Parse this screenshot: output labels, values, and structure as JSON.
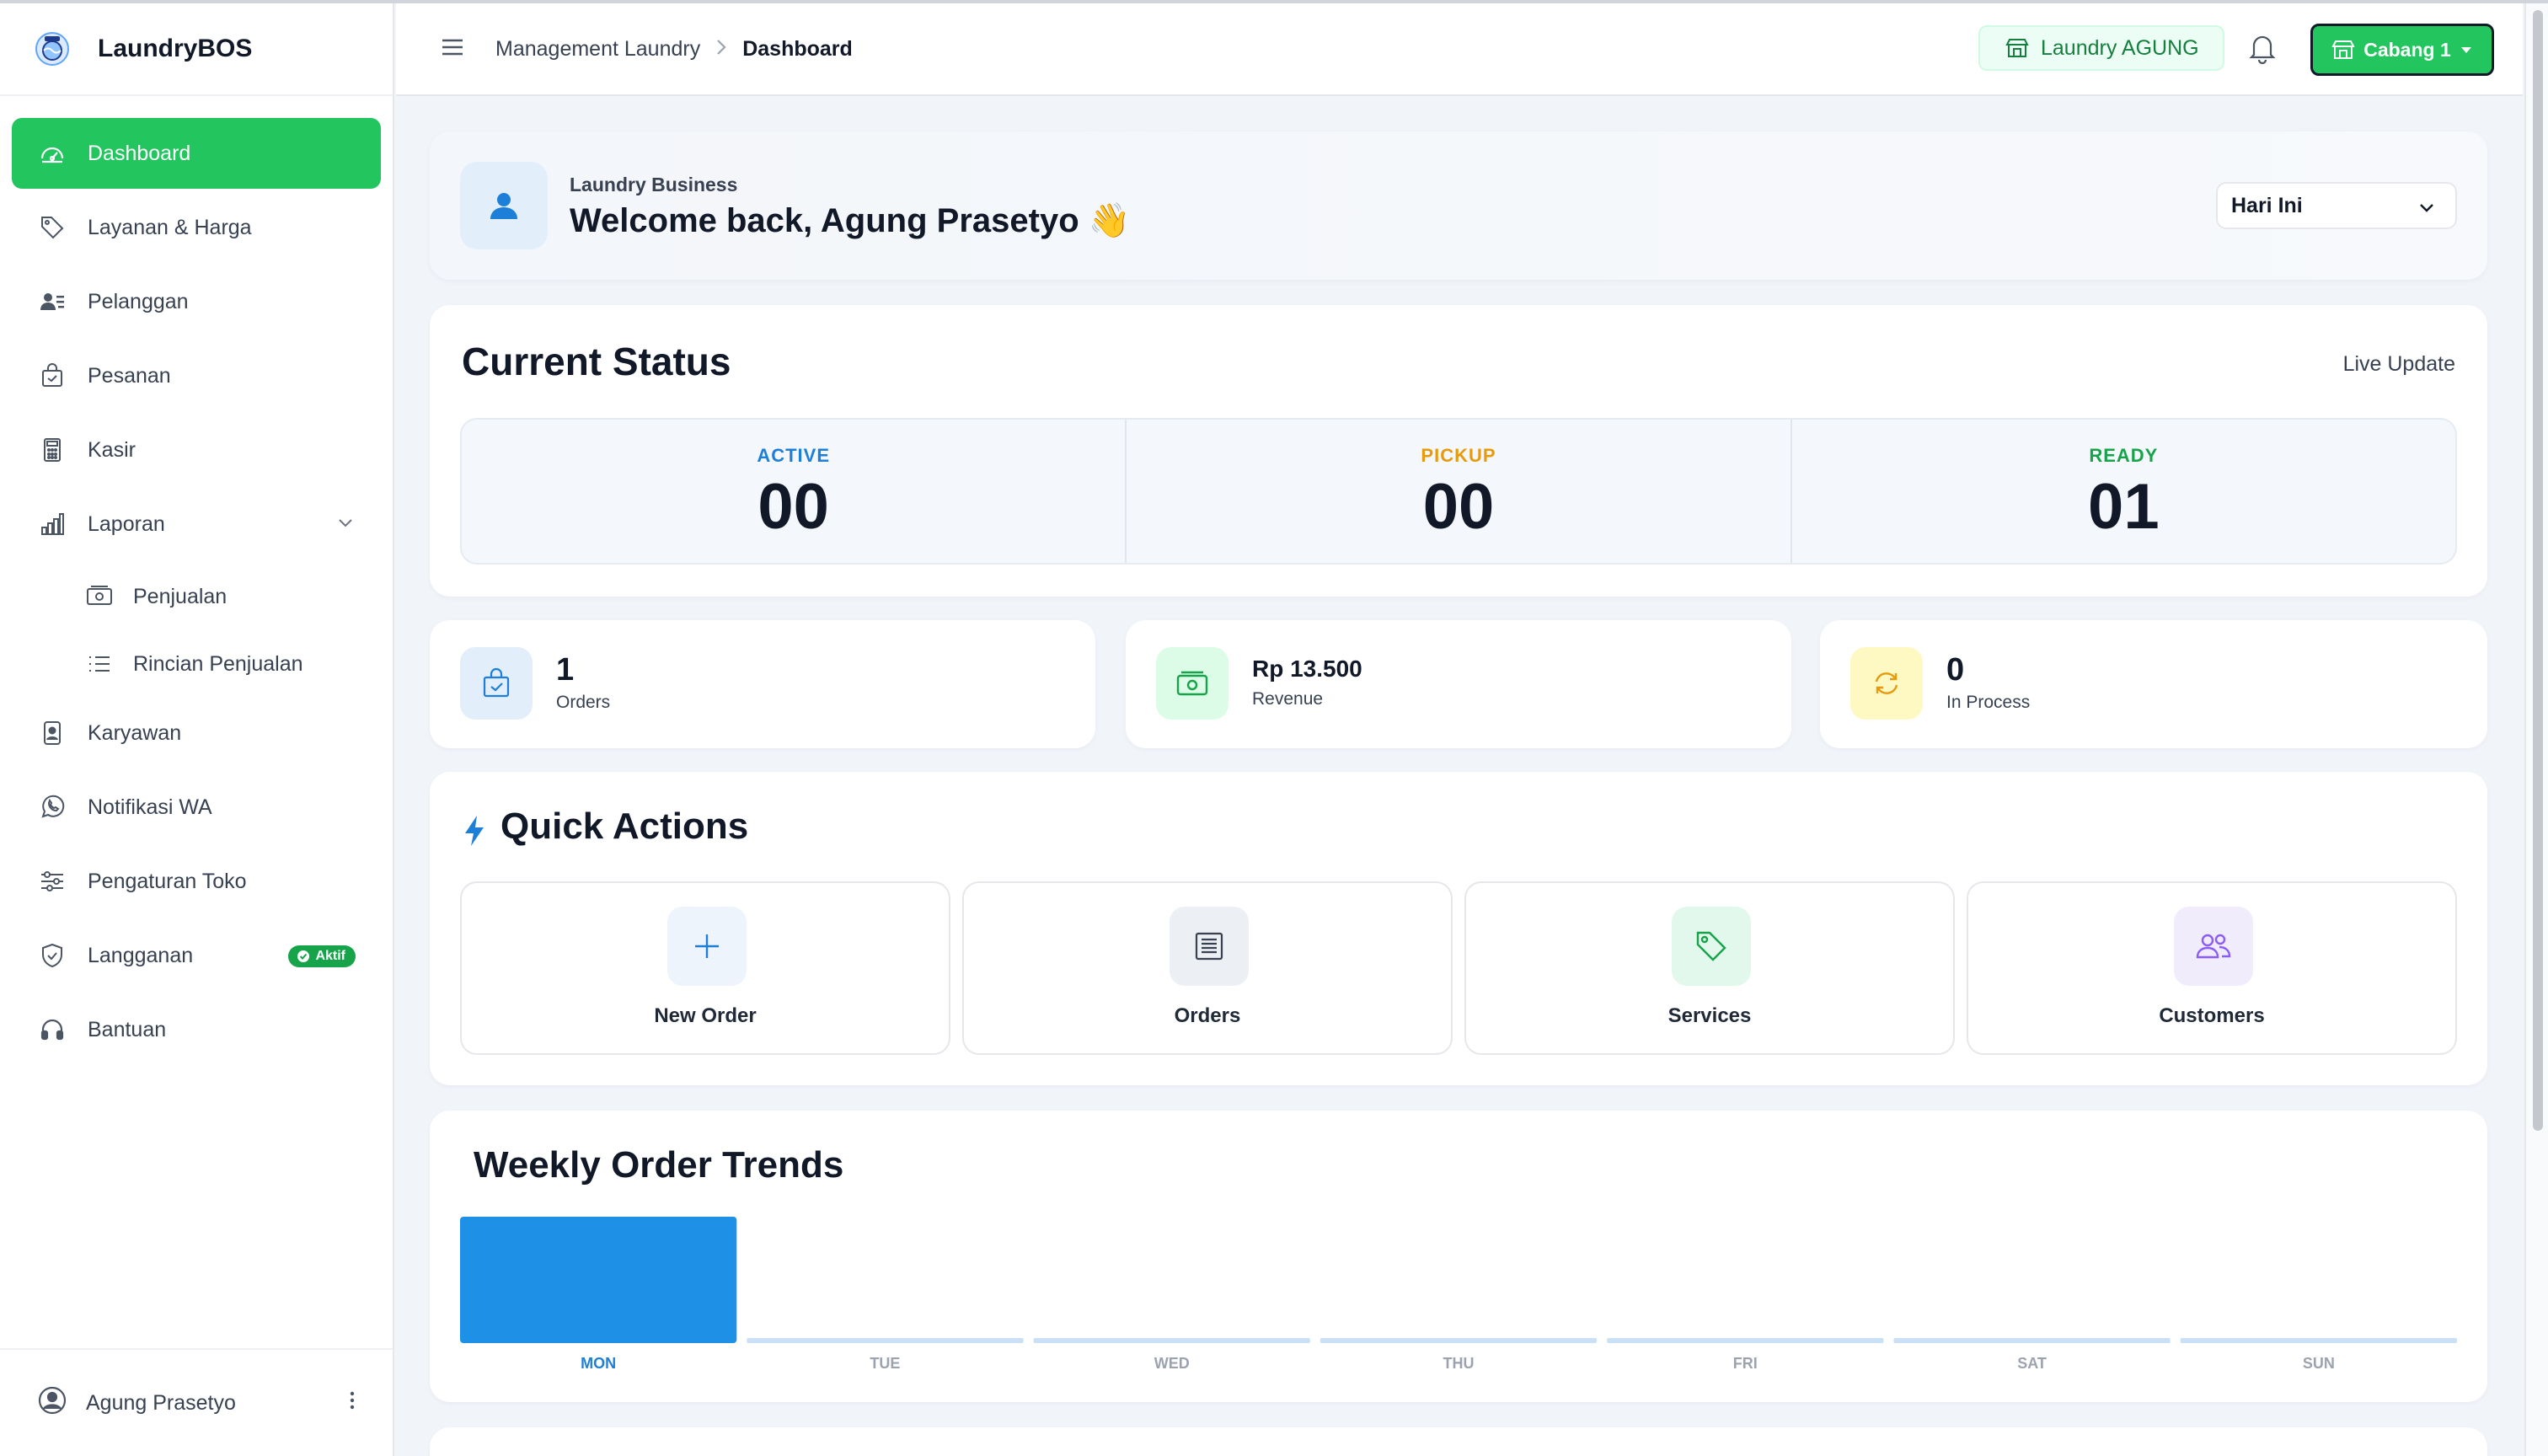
{
  "brand": {
    "name": "LaundryBOS"
  },
  "sidebar": {
    "items": [
      {
        "label": "Dashboard",
        "icon": "dashboard-icon",
        "active": true
      },
      {
        "label": "Layanan & Harga",
        "icon": "tag-icon"
      },
      {
        "label": "Pelanggan",
        "icon": "users-icon"
      },
      {
        "label": "Pesanan",
        "icon": "shopping-bag-icon"
      },
      {
        "label": "Kasir",
        "icon": "calculator-icon"
      },
      {
        "label": "Laporan",
        "icon": "bar-chart-icon",
        "expanded": true,
        "children": [
          {
            "label": "Penjualan",
            "icon": "cash-icon"
          },
          {
            "label": "Rincian Penjualan",
            "icon": "list-icon"
          }
        ]
      },
      {
        "label": "Karyawan",
        "icon": "id-badge-icon"
      },
      {
        "label": "Notifikasi WA",
        "icon": "whatsapp-icon"
      },
      {
        "label": "Pengaturan Toko",
        "icon": "sliders-icon"
      },
      {
        "label": "Langganan",
        "icon": "shield-icon",
        "badge": "Aktif"
      },
      {
        "label": "Bantuan",
        "icon": "headset-icon"
      }
    ],
    "user": {
      "name": "Agung Prasetyo"
    }
  },
  "topbar": {
    "breadcrumb": [
      "Management Laundry",
      "Dashboard"
    ],
    "store": "Laundry AGUNG",
    "branch": "Cabang 1"
  },
  "welcome": {
    "subtitle": "Laundry Business",
    "title": "Welcome back, Agung Prasetyo 👋",
    "period": "Hari Ini"
  },
  "status": {
    "title": "Current Status",
    "live": "Live Update",
    "items": [
      {
        "label": "ACTIVE",
        "value": "00",
        "color": "#1d7fd8"
      },
      {
        "label": "PICKUP",
        "value": "00",
        "color": "#e69a0c"
      },
      {
        "label": "READY",
        "value": "01",
        "color": "#16a34a"
      }
    ]
  },
  "summary": [
    {
      "value": "1",
      "label": "Orders",
      "icon": "shopping-bag-icon",
      "bg": "#e3eefb",
      "color": "#1d7fd8"
    },
    {
      "value": "Rp 13.500",
      "label": "Revenue",
      "icon": "cash-icon",
      "bg": "#dcfce7",
      "color": "#16a34a"
    },
    {
      "value": "0",
      "label": "In Process",
      "icon": "refresh-icon",
      "bg": "#fef9c3",
      "color": "#e69a0c"
    }
  ],
  "quick": {
    "title": "Quick Actions",
    "items": [
      {
        "label": "New Order",
        "icon": "plus-icon"
      },
      {
        "label": "Orders",
        "icon": "list-doc-icon"
      },
      {
        "label": "Services",
        "icon": "tag-icon"
      },
      {
        "label": "Customers",
        "icon": "users-icon"
      }
    ]
  },
  "chart_data": {
    "type": "bar",
    "title": "Weekly Order Trends",
    "categories": [
      "MON",
      "TUE",
      "WED",
      "THU",
      "FRI",
      "SAT",
      "SUN"
    ],
    "values": [
      1,
      0,
      0,
      0,
      0,
      0,
      0
    ],
    "ylim": [
      0,
      1
    ],
    "active_category": "MON",
    "bar_color": "#1e90e6",
    "empty_color": "#c9e0f7"
  }
}
